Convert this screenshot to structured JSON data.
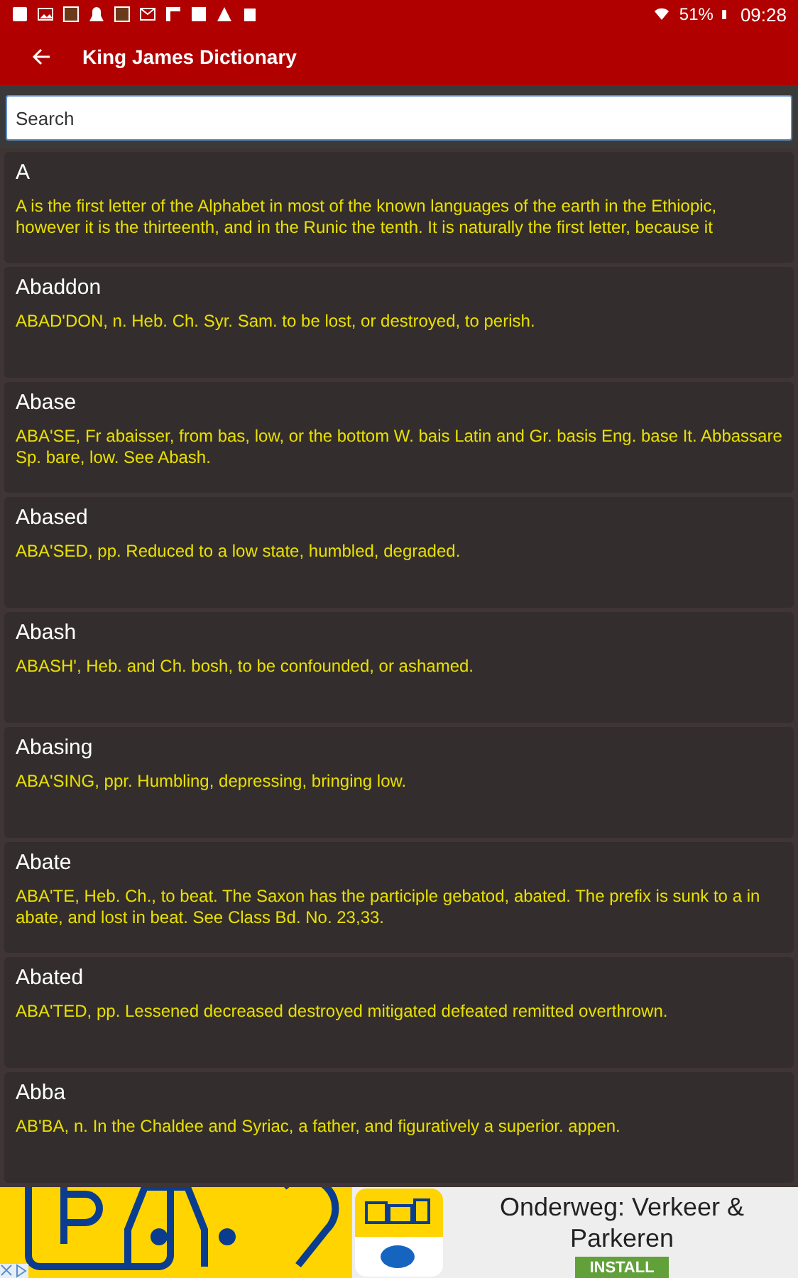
{
  "status_bar": {
    "battery": "51%",
    "time": "09:28"
  },
  "app_bar": {
    "title": "King James Dictionary"
  },
  "search": {
    "placeholder": "Search"
  },
  "entries": [
    {
      "word": "A",
      "definition": "A is the first letter of the Alphabet in most of the known languages of the earth in the Ethiopic, however it is the thirteenth, and in the Runic the tenth. It is naturally the first letter, because it"
    },
    {
      "word": "Abaddon",
      "definition": "ABAD'DON, n. Heb. Ch. Syr. Sam. to be lost, or destroyed, to perish."
    },
    {
      "word": "Abase",
      "definition": "ABA'SE, Fr abaisser, from bas, low, or the bottom W. bais Latin and Gr. basis Eng. base It. Abbassare Sp. bare, low. See Abash."
    },
    {
      "word": "Abased",
      "definition": "ABA'SED, pp. Reduced to a low state, humbled, degraded."
    },
    {
      "word": "Abash",
      "definition": "ABASH', Heb. and Ch. bosh, to be confounded, or ashamed."
    },
    {
      "word": "Abasing",
      "definition": "ABA'SING, ppr. Humbling, depressing, bringing low."
    },
    {
      "word": "Abate",
      "definition": "ABA'TE, Heb. Ch., to beat. The Saxon has the participle gebatod, abated. The prefix is sunk to a in abate, and lost in beat. See Class Bd. No. 23,33."
    },
    {
      "word": "Abated",
      "definition": "ABA'TED, pp. Lessened decreased destroyed mitigated defeated remitted overthrown."
    },
    {
      "word": "Abba",
      "definition": "AB'BA, n. In the Chaldee and Syriac, a father, and figuratively a superior. appen."
    }
  ],
  "ad": {
    "title": "Onderweg: Verkeer & Parkeren",
    "button": "INSTALL"
  }
}
